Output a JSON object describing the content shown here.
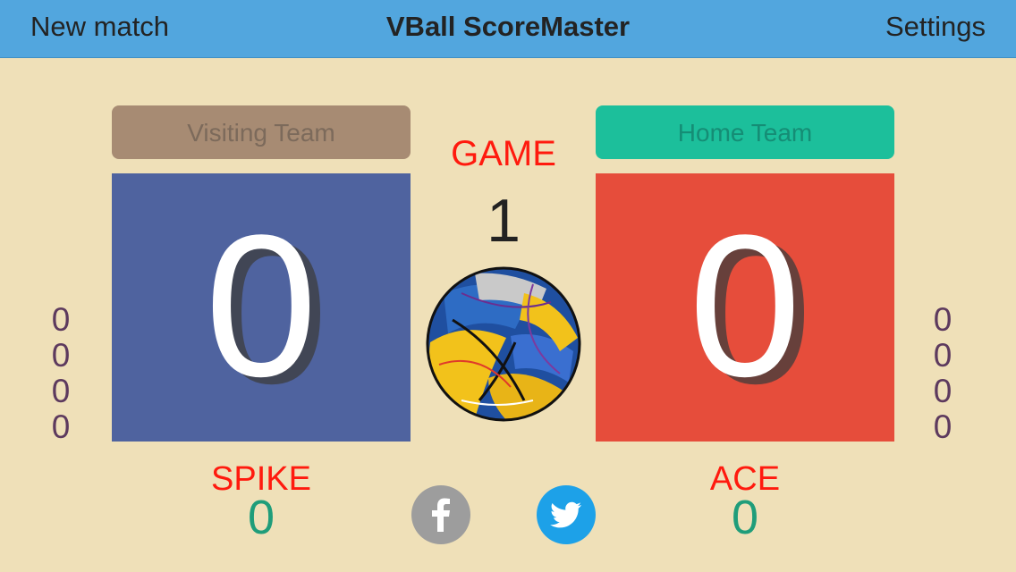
{
  "navbar": {
    "left_label": "New match",
    "title": "VBall ScoreMaster",
    "right_label": "Settings"
  },
  "teams": {
    "visiting": {
      "name": "Visiting Team",
      "score": "0",
      "set_scores": [
        "0",
        "0",
        "0",
        "0"
      ],
      "player_label": "SPIKE",
      "player_value": "0",
      "color": "#4f639f"
    },
    "home": {
      "name": "Home Team",
      "score": "0",
      "set_scores": [
        "0",
        "0",
        "0",
        "0"
      ],
      "player_label": "ACE",
      "player_value": "0",
      "color": "#e64d3b"
    }
  },
  "game": {
    "label": "GAME",
    "number": "1"
  },
  "icons": {
    "ball": "volleyball-icon",
    "facebook": "facebook-icon",
    "twitter": "twitter-icon"
  },
  "colors": {
    "navbar": "#52a6de",
    "background": "#efe0b8",
    "accent_red": "#ff1a0e",
    "accent_green": "#1f9d7a"
  }
}
